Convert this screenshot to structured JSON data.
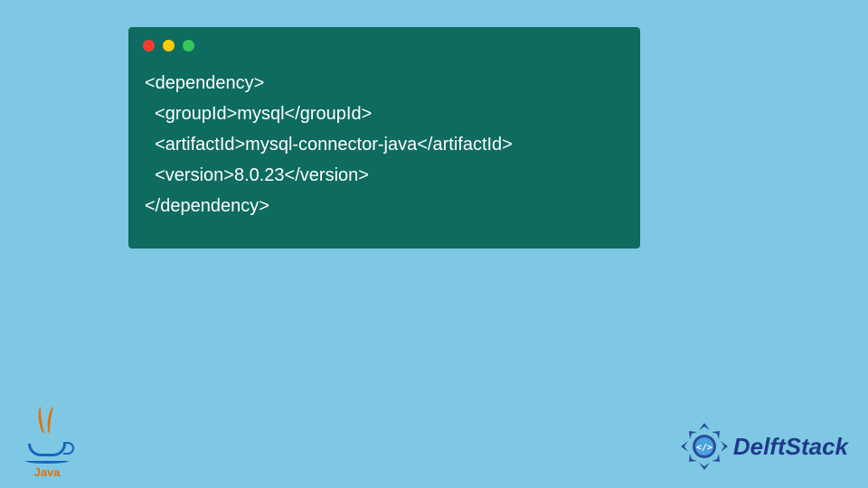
{
  "code": {
    "line1": "<dependency>",
    "line2": "  <groupId>mysql</groupId>",
    "line3": "  <artifactId>mysql-connector-java</artifactId>",
    "line4": "  <version>8.0.23</version>",
    "line5": "</dependency>"
  },
  "java": {
    "label": "Java"
  },
  "delft": {
    "label": "DelftStack"
  }
}
